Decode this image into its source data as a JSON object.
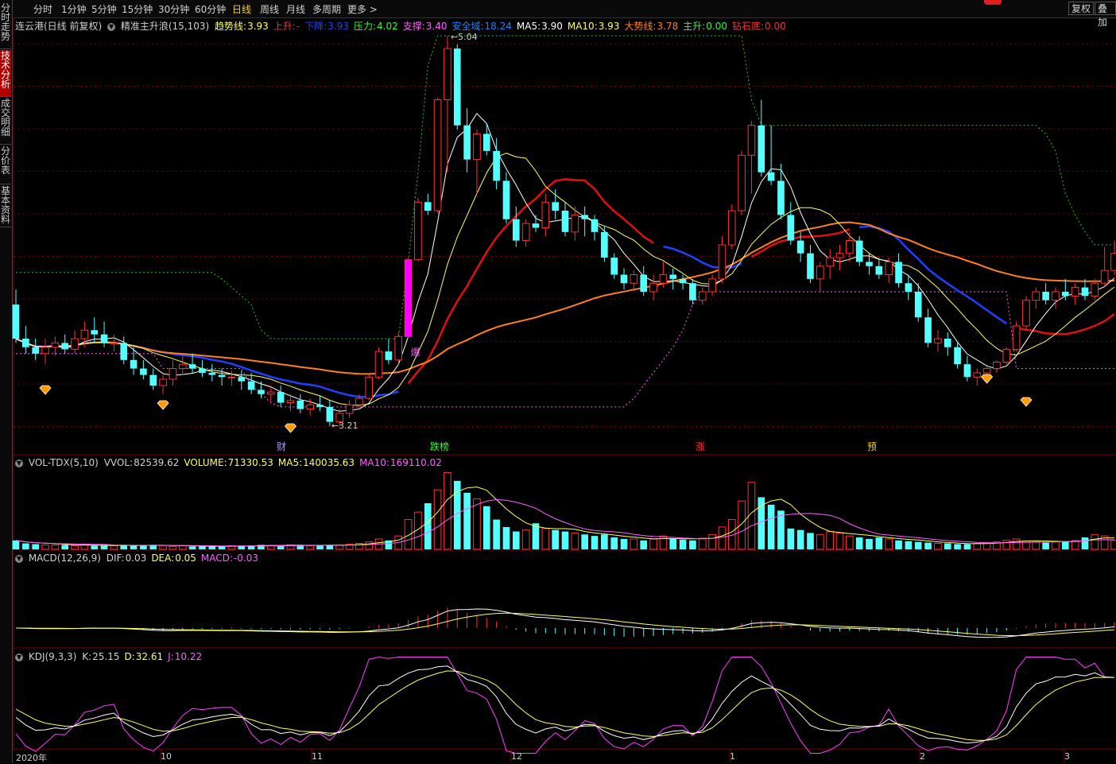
{
  "colors": {
    "up": "#ff3030",
    "down": "#54ffff",
    "ma5": "#ffffff",
    "ma10": "#ffff60",
    "pink": "#ff00ff",
    "blue": "#2040ff",
    "orange": "#ff8020",
    "green": "#30c030",
    "grid": "#7a0000"
  },
  "toolbar": {
    "periods": [
      "分时",
      "1分钟",
      "5分钟",
      "15分钟",
      "30分钟",
      "60分钟",
      "日线",
      "周线",
      "月线",
      "多周期",
      "更多 >"
    ],
    "active_index": 6,
    "restore_label": "复权",
    "overlay_label": "叠加"
  },
  "sidebar": {
    "tabs": [
      "分时走势",
      "技术分析",
      "成交明细",
      "分价表",
      "基本资料"
    ],
    "active_index": 1
  },
  "main_panel": {
    "stock": "连云港(日线 前复权)",
    "indicator_name": "精准主升浪(15,103)",
    "items": [
      {
        "label": "趋势线:",
        "value": "3.93",
        "color": "#ffff60"
      },
      {
        "label": "上升:",
        "value": "-",
        "color": "#ff3030"
      },
      {
        "label": "下降:",
        "value": "3.93",
        "color": "#2040ff"
      },
      {
        "label": "压力:",
        "value": "4.02",
        "color": "#30ff30"
      },
      {
        "label": "支撑:",
        "value": "3.40",
        "color": "#ff60ff"
      },
      {
        "label": "安全域:",
        "value": "18.24",
        "color": "#2080ff"
      },
      {
        "label": "MA5:",
        "value": "3.90",
        "color": "#ffffff"
      },
      {
        "label": "MA10:",
        "value": "3.93",
        "color": "#ffff60"
      },
      {
        "label": "大势线:",
        "value": "3.78",
        "color": "#ff8020"
      },
      {
        "label": "主升:",
        "value": "0.00",
        "color": "#30ff30"
      },
      {
        "label": "钻石底:",
        "value": "0.00",
        "color": "#ff3030"
      }
    ],
    "high_label": "5.04",
    "low_label": "3.21",
    "markers": [
      {
        "text": "财",
        "color": "#a0a0ff"
      },
      {
        "text": "跌榜",
        "color": "#30ff30"
      },
      {
        "text": "涨",
        "color": "#ff3030"
      },
      {
        "text": "预",
        "color": "#ffd700"
      }
    ],
    "burst_label": "爆"
  },
  "vol_panel": {
    "name": "VOL-TDX(5,10)",
    "items": [
      {
        "label": "VVOL:",
        "value": "82539.62",
        "color": "#d0d0d0"
      },
      {
        "label": "VOLUME:",
        "value": "71330.53",
        "color": "#ffff60"
      },
      {
        "label": "MA5:",
        "value": "140035.63",
        "color": "#ffff60"
      },
      {
        "label": "MA10:",
        "value": "169110.02",
        "color": "#ff60ff"
      }
    ]
  },
  "macd_panel": {
    "name": "MACD(12,26,9)",
    "items": [
      {
        "label": "DIF:",
        "value": "0.03",
        "color": "#d0d0d0"
      },
      {
        "label": "DEA:",
        "value": "0.05",
        "color": "#ffff60"
      },
      {
        "label": "MACD:",
        "value": "-0.03",
        "color": "#ff60ff"
      }
    ]
  },
  "kdj_panel": {
    "name": "KDJ(9,3,3)",
    "items": [
      {
        "label": "K:",
        "value": "25.15",
        "color": "#d0d0d0"
      },
      {
        "label": "D:",
        "value": "32.61",
        "color": "#ffff60"
      },
      {
        "label": "J:",
        "value": "10.22",
        "color": "#ff60ff"
      }
    ]
  },
  "x_axis": [
    "2020年",
    "10",
    "11",
    "12",
    "1",
    "2",
    "3"
  ],
  "chart_data": {
    "type": "candlestick",
    "ohlc": [
      [
        3.78,
        3.85,
        3.6,
        3.62
      ],
      [
        3.62,
        3.68,
        3.55,
        3.58
      ],
      [
        3.58,
        3.62,
        3.52,
        3.55
      ],
      [
        3.55,
        3.62,
        3.5,
        3.58
      ],
      [
        3.58,
        3.63,
        3.54,
        3.6
      ],
      [
        3.6,
        3.64,
        3.55,
        3.57
      ],
      [
        3.57,
        3.66,
        3.55,
        3.62
      ],
      [
        3.62,
        3.7,
        3.58,
        3.66
      ],
      [
        3.66,
        3.72,
        3.6,
        3.64
      ],
      [
        3.64,
        3.7,
        3.58,
        3.6
      ],
      [
        3.6,
        3.64,
        3.56,
        3.6
      ],
      [
        3.6,
        3.63,
        3.5,
        3.52
      ],
      [
        3.52,
        3.58,
        3.45,
        3.48
      ],
      [
        3.48,
        3.52,
        3.43,
        3.45
      ],
      [
        3.45,
        3.48,
        3.38,
        3.4
      ],
      [
        3.4,
        3.45,
        3.36,
        3.43
      ],
      [
        3.43,
        3.52,
        3.4,
        3.48
      ],
      [
        3.48,
        3.54,
        3.45,
        3.5
      ],
      [
        3.5,
        3.55,
        3.46,
        3.48
      ],
      [
        3.48,
        3.52,
        3.44,
        3.46
      ],
      [
        3.46,
        3.5,
        3.42,
        3.45
      ],
      [
        3.45,
        3.48,
        3.4,
        3.44
      ],
      [
        3.44,
        3.47,
        3.4,
        3.44
      ],
      [
        3.44,
        3.47,
        3.38,
        3.42
      ],
      [
        3.42,
        3.46,
        3.36,
        3.38
      ],
      [
        3.38,
        3.42,
        3.34,
        3.36
      ],
      [
        3.36,
        3.4,
        3.32,
        3.37
      ],
      [
        3.37,
        3.4,
        3.3,
        3.32
      ],
      [
        3.32,
        3.36,
        3.28,
        3.33
      ],
      [
        3.33,
        3.36,
        3.27,
        3.29
      ],
      [
        3.29,
        3.34,
        3.26,
        3.31
      ],
      [
        3.31,
        3.35,
        3.28,
        3.3
      ],
      [
        3.3,
        3.33,
        3.21,
        3.23
      ],
      [
        3.23,
        3.29,
        3.21,
        3.27
      ],
      [
        3.27,
        3.33,
        3.25,
        3.31
      ],
      [
        3.31,
        3.36,
        3.29,
        3.34
      ],
      [
        3.34,
        3.45,
        3.33,
        3.44
      ],
      [
        3.44,
        3.58,
        3.43,
        3.56
      ],
      [
        3.56,
        3.62,
        3.5,
        3.52
      ],
      [
        3.52,
        3.65,
        3.5,
        3.63
      ],
      [
        3.63,
        4.0,
        3.62,
        3.99
      ],
      [
        3.99,
        4.28,
        3.98,
        4.26
      ],
      [
        4.26,
        4.3,
        4.2,
        4.22
      ],
      [
        4.22,
        4.75,
        4.21,
        4.74
      ],
      [
        4.74,
        5.04,
        4.4,
        4.98
      ],
      [
        4.98,
        5.0,
        4.6,
        4.62
      ],
      [
        4.62,
        4.7,
        4.4,
        4.46
      ],
      [
        4.46,
        4.6,
        4.3,
        4.58
      ],
      [
        4.58,
        4.63,
        4.48,
        4.5
      ],
      [
        4.5,
        4.56,
        4.32,
        4.36
      ],
      [
        4.36,
        4.4,
        4.16,
        4.18
      ],
      [
        4.18,
        4.24,
        4.05,
        4.08
      ],
      [
        4.08,
        4.18,
        4.05,
        4.16
      ],
      [
        4.16,
        4.2,
        4.12,
        4.14
      ],
      [
        4.14,
        4.3,
        4.1,
        4.26
      ],
      [
        4.26,
        4.32,
        4.18,
        4.22
      ],
      [
        4.22,
        4.26,
        4.1,
        4.12
      ],
      [
        4.12,
        4.24,
        4.08,
        4.2
      ],
      [
        4.2,
        4.24,
        4.1,
        4.18
      ],
      [
        4.18,
        4.2,
        4.08,
        4.12
      ],
      [
        4.12,
        4.15,
        3.98,
        4.0
      ],
      [
        4.0,
        4.02,
        3.9,
        3.92
      ],
      [
        3.92,
        3.95,
        3.85,
        3.88
      ],
      [
        3.88,
        3.94,
        3.84,
        3.92
      ],
      [
        3.92,
        3.96,
        3.82,
        3.84
      ],
      [
        3.84,
        3.92,
        3.8,
        3.88
      ],
      [
        3.88,
        3.98,
        3.86,
        3.92
      ],
      [
        3.92,
        3.95,
        3.85,
        3.9
      ],
      [
        3.9,
        3.92,
        3.85,
        3.88
      ],
      [
        3.88,
        3.9,
        3.78,
        3.8
      ],
      [
        3.8,
        3.86,
        3.78,
        3.84
      ],
      [
        3.84,
        3.92,
        3.82,
        3.9
      ],
      [
        3.9,
        4.1,
        3.88,
        4.06
      ],
      [
        4.06,
        4.25,
        4.04,
        4.22
      ],
      [
        4.22,
        4.5,
        4.2,
        4.48
      ],
      [
        4.48,
        4.64,
        4.3,
        4.62
      ],
      [
        4.62,
        4.74,
        4.38,
        4.4
      ],
      [
        4.4,
        4.62,
        4.34,
        4.36
      ],
      [
        4.36,
        4.44,
        4.18,
        4.2
      ],
      [
        4.2,
        4.26,
        4.06,
        4.08
      ],
      [
        4.08,
        4.12,
        3.98,
        4.02
      ],
      [
        4.02,
        4.06,
        3.88,
        3.9
      ],
      [
        3.9,
        3.98,
        3.84,
        3.96
      ],
      [
        3.96,
        4.04,
        3.9,
        4.0
      ],
      [
        4.0,
        4.06,
        3.94,
        4.02
      ],
      [
        4.02,
        4.12,
        3.98,
        4.08
      ],
      [
        4.08,
        4.1,
        3.96,
        3.98
      ],
      [
        3.98,
        4.02,
        3.92,
        3.96
      ],
      [
        3.96,
        4.0,
        3.9,
        3.92
      ],
      [
        3.92,
        4.0,
        3.88,
        3.98
      ],
      [
        3.98,
        4.02,
        3.86,
        3.88
      ],
      [
        3.88,
        3.92,
        3.8,
        3.84
      ],
      [
        3.84,
        3.88,
        3.7,
        3.72
      ],
      [
        3.72,
        3.76,
        3.58,
        3.6
      ],
      [
        3.6,
        3.66,
        3.56,
        3.62
      ],
      [
        3.62,
        3.65,
        3.54,
        3.58
      ],
      [
        3.58,
        3.6,
        3.48,
        3.5
      ],
      [
        3.5,
        3.54,
        3.42,
        3.44
      ],
      [
        3.44,
        3.48,
        3.4,
        3.46
      ],
      [
        3.46,
        3.5,
        3.44,
        3.48
      ],
      [
        3.48,
        3.52,
        3.46,
        3.51
      ],
      [
        3.51,
        3.58,
        3.5,
        3.57
      ],
      [
        3.57,
        3.7,
        3.56,
        3.68
      ],
      [
        3.68,
        3.82,
        3.66,
        3.8
      ],
      [
        3.8,
        3.86,
        3.76,
        3.84
      ],
      [
        3.84,
        3.88,
        3.78,
        3.8
      ],
      [
        3.8,
        3.86,
        3.76,
        3.84
      ],
      [
        3.84,
        3.9,
        3.8,
        3.82
      ],
      [
        3.82,
        3.88,
        3.78,
        3.86
      ],
      [
        3.86,
        3.9,
        3.8,
        3.82
      ],
      [
        3.82,
        3.9,
        3.8,
        3.88
      ],
      [
        3.88,
        4.05,
        3.86,
        3.94
      ],
      [
        3.94,
        4.08,
        3.92,
        4.02
      ]
    ],
    "volume": [
      12,
      8,
      7,
      6,
      6,
      6,
      5,
      6,
      5,
      5,
      5,
      6,
      5,
      5,
      6,
      5,
      4,
      5,
      4,
      4,
      4,
      4,
      5,
      5,
      5,
      6,
      5,
      5,
      6,
      6,
      5,
      5,
      6,
      6,
      7,
      8,
      10,
      14,
      12,
      18,
      40,
      50,
      62,
      80,
      103,
      92,
      76,
      68,
      58,
      40,
      30,
      24,
      26,
      35,
      28,
      26,
      24,
      22,
      20,
      18,
      20,
      16,
      14,
      14,
      12,
      14,
      18,
      14,
      13,
      12,
      15,
      20,
      30,
      40,
      65,
      90,
      70,
      60,
      52,
      28,
      26,
      22,
      20,
      24,
      22,
      18,
      16,
      14,
      16,
      14,
      12,
      11,
      10,
      9,
      8,
      8,
      7,
      7,
      8,
      9,
      10,
      12,
      14,
      11,
      10,
      9,
      10,
      11,
      12,
      16,
      20,
      18,
      12
    ],
    "volume_ymax": 110
  }
}
